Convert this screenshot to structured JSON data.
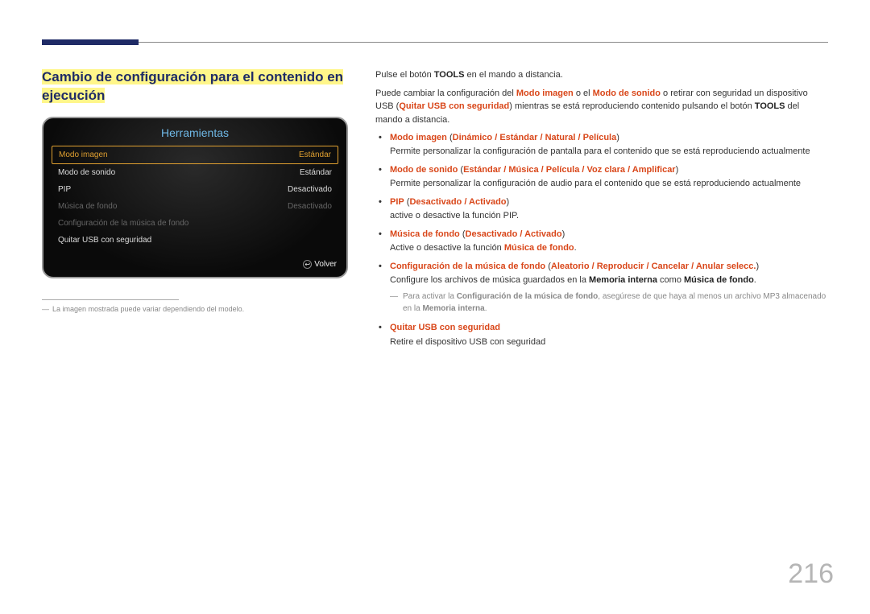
{
  "pageNumber": "216",
  "heading": "Cambio de configuración para el contenido en ejecución",
  "tv": {
    "title": "Herramientas",
    "rows": [
      {
        "label": "Modo imagen",
        "value": "Estándar",
        "state": "selected"
      },
      {
        "label": "Modo de sonido",
        "value": "Estándar",
        "state": ""
      },
      {
        "label": "PIP",
        "value": "Desactivado",
        "state": ""
      },
      {
        "label": "Música de fondo",
        "value": "Desactivado",
        "state": "dim"
      },
      {
        "label": "Configuración de la música de fondo",
        "value": "",
        "state": "dim"
      },
      {
        "label": "Quitar USB con seguridad",
        "value": "",
        "state": ""
      }
    ],
    "footer": "Volver",
    "footerIcon": "↩"
  },
  "footnote": "La imagen mostrada puede variar dependiendo del modelo.",
  "intro": {
    "line1_a": "Pulse el botón ",
    "line1_b": "TOOLS",
    "line1_c": " en el mando a distancia.",
    "line2_a": "Puede cambiar la configuración del ",
    "line2_b": "Modo imagen",
    "line2_c": " o el ",
    "line2_d": "Modo de sonido",
    "line2_e": " o retirar con seguridad un dispositivo USB (",
    "line2_f": "Quitar USB con seguridad",
    "line2_g": ") mientras se está reproduciendo contenido pulsando el botón ",
    "line2_h": "TOOLS",
    "line2_i": " del mando a distancia."
  },
  "items": {
    "i1": {
      "t0": "Modo imagen",
      "op": " (",
      "t1": "Dinámico",
      "s1": " / ",
      "t2": "Estándar",
      "s2": " / ",
      "t3": "Natural",
      "s3": " / ",
      "t4": "Película",
      "cp": ")",
      "desc": "Permite personalizar la configuración de pantalla para el contenido que se está reproduciendo actualmente"
    },
    "i2": {
      "t0": "Modo de sonido",
      "op": " (",
      "t1": "Estándar",
      "s1": " / ",
      "t2": "Música",
      "s2": " / ",
      "t3": "Película",
      "s3": " / ",
      "t4": "Voz clara",
      "s4": " / ",
      "t5": "Amplificar",
      "cp": ")",
      "desc": "Permite personalizar la configuración de audio para el contenido que se está reproduciendo actualmente"
    },
    "i3": {
      "t0": "PIP",
      "op": " (",
      "t1": "Desactivado",
      "s1": " / ",
      "t2": "Activado",
      "cp": ")",
      "desc": "active o desactive la función PIP."
    },
    "i4": {
      "t0": "Música de fondo",
      "op": " (",
      "t1": "Desactivado",
      "s1": " / ",
      "t2": "Activado",
      "cp": ")",
      "desc_a": "Active o desactive la función ",
      "desc_b": "Música de fondo",
      "desc_c": "."
    },
    "i5": {
      "t0": "Configuración de la música de fondo",
      "op": " (",
      "t1": "Aleatorio",
      "s1": " / ",
      "t2": "Reproducir",
      "s2": " / ",
      "t3": "Cancelar",
      "s3": " / ",
      "t4": "Anular selecc.",
      "cp": ")",
      "desc_a": "Configure los archivos de música guardados en la ",
      "desc_b": "Memoria interna",
      "desc_c": " como ",
      "desc_d": "Música de fondo",
      "desc_e": "."
    },
    "i6": {
      "t0": "Quitar USB con seguridad",
      "desc": "Retire el dispositivo USB con seguridad"
    }
  },
  "note": {
    "a": "Para activar la ",
    "b": "Configuración de la música de fondo",
    "c": ", asegúrese de que haya al menos un archivo MP3 almacenado en la ",
    "d": "Memoria interna",
    "e": "."
  }
}
